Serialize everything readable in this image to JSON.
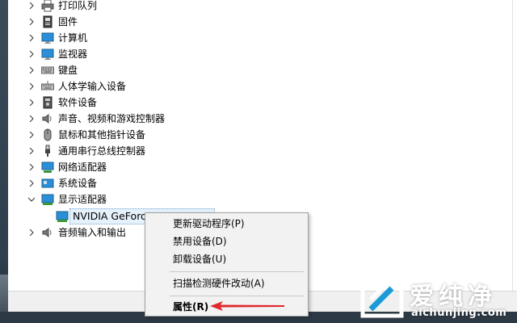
{
  "tree": {
    "items": [
      {
        "label": "打印队列",
        "icon": "printer-icon",
        "expanded": false
      },
      {
        "label": "固件",
        "icon": "firmware-icon",
        "expanded": false
      },
      {
        "label": "计算机",
        "icon": "computer-icon",
        "expanded": false
      },
      {
        "label": "监视器",
        "icon": "monitor-icon",
        "expanded": false
      },
      {
        "label": "键盘",
        "icon": "keyboard-icon",
        "expanded": false
      },
      {
        "label": "人体学输入设备",
        "icon": "hid-icon",
        "expanded": false
      },
      {
        "label": "软件设备",
        "icon": "software-device-icon",
        "expanded": false
      },
      {
        "label": "声音、视频和游戏控制器",
        "icon": "speaker-icon",
        "expanded": false
      },
      {
        "label": "鼠标和其他指针设备",
        "icon": "mouse-icon",
        "expanded": false
      },
      {
        "label": "通用串行总线控制器",
        "icon": "usb-icon",
        "expanded": false
      },
      {
        "label": "网络适配器",
        "icon": "network-adapter-icon",
        "expanded": false
      },
      {
        "label": "系统设备",
        "icon": "system-device-icon",
        "expanded": false
      },
      {
        "label": "显示适配器",
        "icon": "display-adapter-icon",
        "expanded": true
      },
      {
        "label": "音频输入和输出",
        "icon": "speaker-icon",
        "expanded": false
      }
    ],
    "child": {
      "label": "NVIDIA GeForce",
      "icon": "display-adapter-icon"
    }
  },
  "context_menu": {
    "items": [
      {
        "label": "更新驱动程序(P)"
      },
      {
        "label": "禁用设备(D)"
      },
      {
        "label": "卸载设备(U)"
      },
      {
        "label": "扫描检测硬件改动(A)"
      },
      {
        "label": "属性(R)",
        "bold": true
      }
    ]
  },
  "watermark": {
    "brand": "爱纯净",
    "url": "aichunjing.com"
  },
  "colors": {
    "accent": "#1a9ad6",
    "arrow": "#e0282e",
    "menu_bg": "#f2f2f2"
  }
}
